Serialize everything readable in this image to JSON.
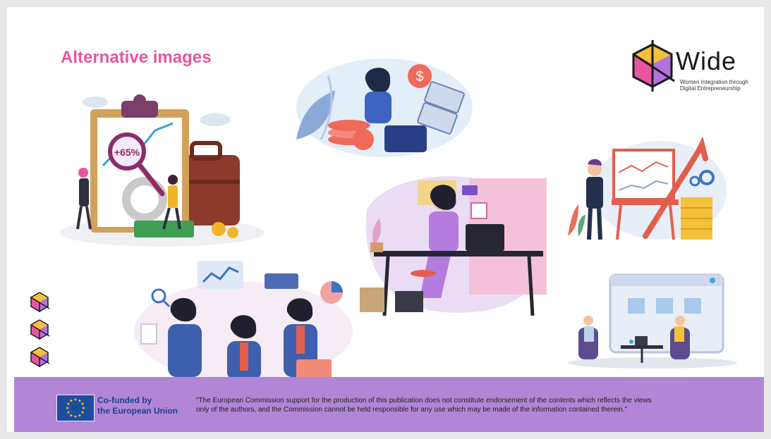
{
  "slide": {
    "title": "Alternative images"
  },
  "logo": {
    "word": "Wide",
    "subtitle_line1": "Women Integration through",
    "subtitle_line2": "Digital Entrepreneurship"
  },
  "illustrations": {
    "clipboard_label": "+65%",
    "dollar_symbol": "$"
  },
  "footer": {
    "cofunded_line1": "Co-funded by",
    "cofunded_line2": "the European Union",
    "disclaimer_line1": "\"The European Commission support for the production of this publication does not constitute endorsement of the contents which reflects the views",
    "disclaimer_line2": "only of the authors, and the Commission cannot be held responsible for any use which may be made of the information contained therein.\""
  },
  "colors": {
    "title": "#e8559f",
    "footer": "#b285d6",
    "eu_blue": "#1d4c9e",
    "eu_star": "#ffd21f"
  }
}
